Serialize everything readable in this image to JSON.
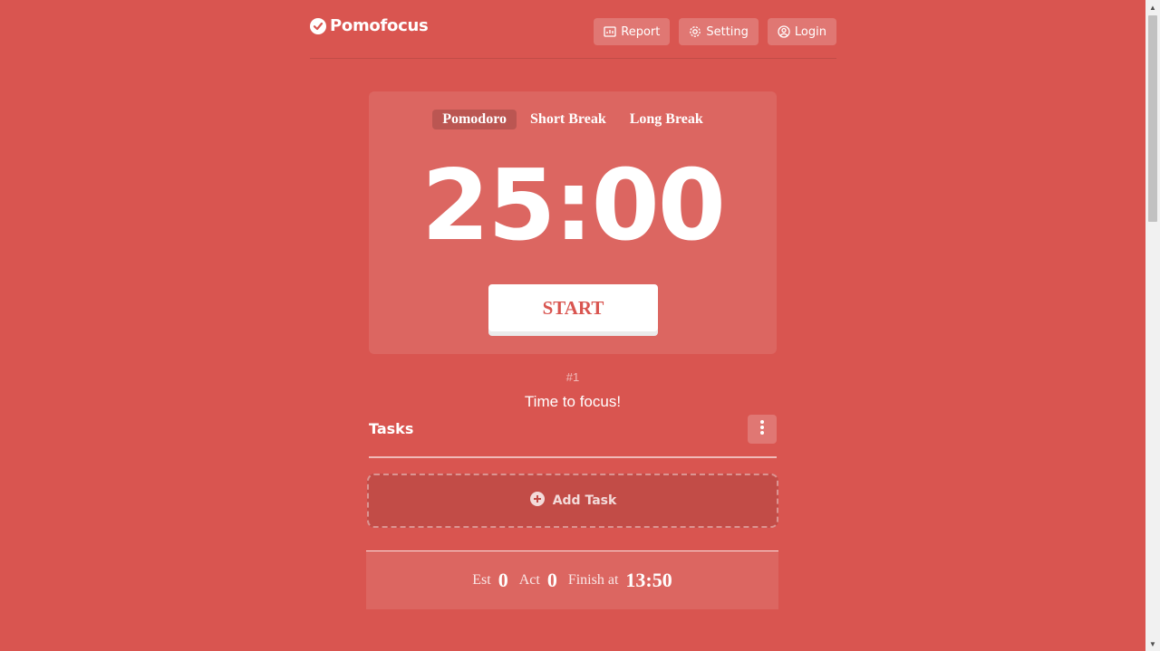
{
  "app": {
    "name": "Pomofocus"
  },
  "nav": {
    "report": "Report",
    "setting": "Setting",
    "login": "Login"
  },
  "timer": {
    "modes": [
      "Pomodoro",
      "Short Break",
      "Long Break"
    ],
    "active_mode": "Pomodoro",
    "time": "25:00",
    "start_label": "START"
  },
  "session": {
    "round": "#1",
    "message": "Time to focus!"
  },
  "tasks": {
    "title": "Tasks",
    "add_label": "Add Task"
  },
  "stats": {
    "est_label": "Est",
    "est_value": "0",
    "act_label": "Act",
    "act_value": "0",
    "finish_label": "Finish at",
    "finish_time": "13:50"
  },
  "colors": {
    "background": "#d95550",
    "accent": "#ffffff"
  }
}
